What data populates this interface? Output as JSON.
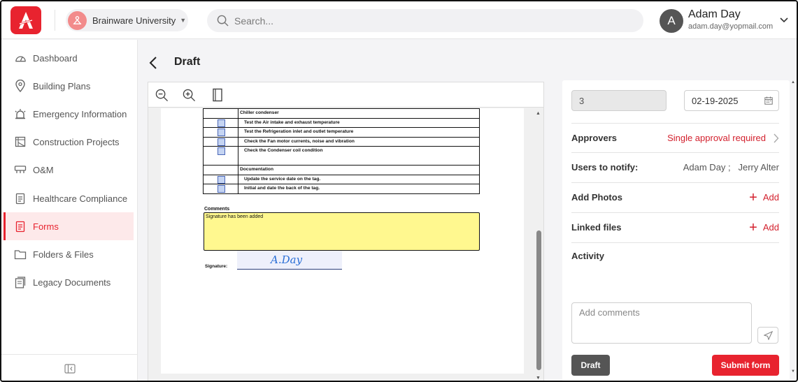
{
  "header": {
    "org_name": "Brainware University",
    "search_placeholder": "Search...",
    "user_initial": "A",
    "user_name": "Adam Day",
    "user_email": "adam.day@yopmail.com"
  },
  "sidebar": {
    "items": [
      {
        "label": "Dashboard",
        "icon": "gauge-icon"
      },
      {
        "label": "Building Plans",
        "icon": "location-pin-icon"
      },
      {
        "label": "Emergency Information",
        "icon": "siren-icon"
      },
      {
        "label": "Construction Projects",
        "icon": "crane-icon"
      },
      {
        "label": "O&M",
        "icon": "equipment-icon"
      },
      {
        "label": "Healthcare Compliance",
        "icon": "clipboard-icon"
      },
      {
        "label": "Forms",
        "icon": "form-icon",
        "active": true
      },
      {
        "label": "Folders & Files",
        "icon": "folder-icon"
      },
      {
        "label": "Legacy Documents",
        "icon": "documents-icon"
      }
    ]
  },
  "page": {
    "title": "Draft"
  },
  "document": {
    "section_chiller": "Chiller condenser",
    "tasks_chiller": [
      "Test the Air intake and exhaust temperature",
      "Test the Refrigeration inlet and outlet temperature",
      "Check the Fan motor currents, noise and vibration",
      "Check the Condenser coil condition"
    ],
    "section_documentation": "Documentation",
    "tasks_documentation": [
      "Update the service date on the tag.",
      "Initial and date the back of the tag."
    ],
    "comments_label": "Comments",
    "comments_text": "Signature has been added",
    "signature_label": "Signature:",
    "signature_text": "A.Day"
  },
  "panel": {
    "number_value": "3",
    "date_value": "02-19-2025",
    "approvers_label": "Approvers",
    "approvers_value": "Single approval required",
    "notify_label": "Users to notify:",
    "notify_value": "Adam Day ;   Jerry Alter",
    "photos_label": "Add Photos",
    "photos_action": "Add",
    "linked_label": "Linked files",
    "linked_action": "Add",
    "activity_label": "Activity",
    "comment_placeholder": "Add comments",
    "draft_button": "Draft",
    "submit_button": "Submit form"
  },
  "colors": {
    "accent": "#e8232f",
    "highlight": "#fff88f",
    "draft_button": "#555555"
  }
}
